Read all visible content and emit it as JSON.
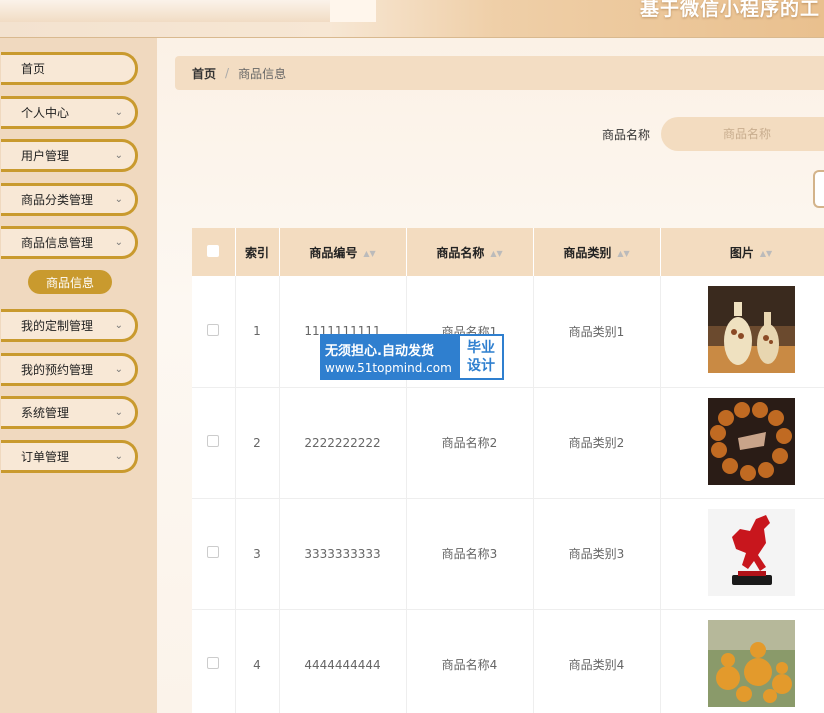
{
  "header": {
    "title": "基于微信小程序的工"
  },
  "sidebar": {
    "items": [
      {
        "label": "首页",
        "has_arrow": false
      },
      {
        "label": "个人中心",
        "has_arrow": true
      },
      {
        "label": "用户管理",
        "has_arrow": true
      },
      {
        "label": "商品分类管理",
        "has_arrow": true
      },
      {
        "label": "商品信息管理",
        "has_arrow": true
      },
      {
        "label": "我的定制管理",
        "has_arrow": true
      },
      {
        "label": "我的预约管理",
        "has_arrow": true
      },
      {
        "label": "系统管理",
        "has_arrow": true
      },
      {
        "label": "订单管理",
        "has_arrow": true
      }
    ],
    "active_sub": "商品信息",
    "chevron": "⌄"
  },
  "breadcrumb": {
    "home": "首页",
    "separator": "/",
    "current": "商品信息"
  },
  "search": {
    "label": "商品名称",
    "placeholder": "商品名称"
  },
  "table": {
    "columns": [
      "索引",
      "商品编号",
      "商品名称",
      "商品类别",
      "图片"
    ],
    "sort_glyph": "▲▼",
    "rows": [
      {
        "index": "1",
        "code": "1111111111",
        "name": "商品名称1",
        "category": "商品类别1",
        "image": "vases"
      },
      {
        "index": "2",
        "code": "2222222222",
        "name": "商品名称2",
        "category": "商品类别2",
        "image": "bead-bracelet"
      },
      {
        "index": "3",
        "code": "3333333333",
        "name": "商品名称3",
        "category": "商品类别3",
        "image": "red-horse"
      },
      {
        "index": "4",
        "code": "4444444444",
        "name": "商品名称4",
        "category": "商品类别4",
        "image": "gourds"
      }
    ]
  },
  "watermark": {
    "line1": "无须担心.自动发货",
    "line2": "www.51topmind.com",
    "badge1": "毕业",
    "badge2": "设计"
  },
  "colors": {
    "accent": "#c99a2e",
    "header_bg": "#f3dcc0",
    "sidebar_bg": "#f0d9bf",
    "watermark_blue": "#2f7fcf"
  }
}
